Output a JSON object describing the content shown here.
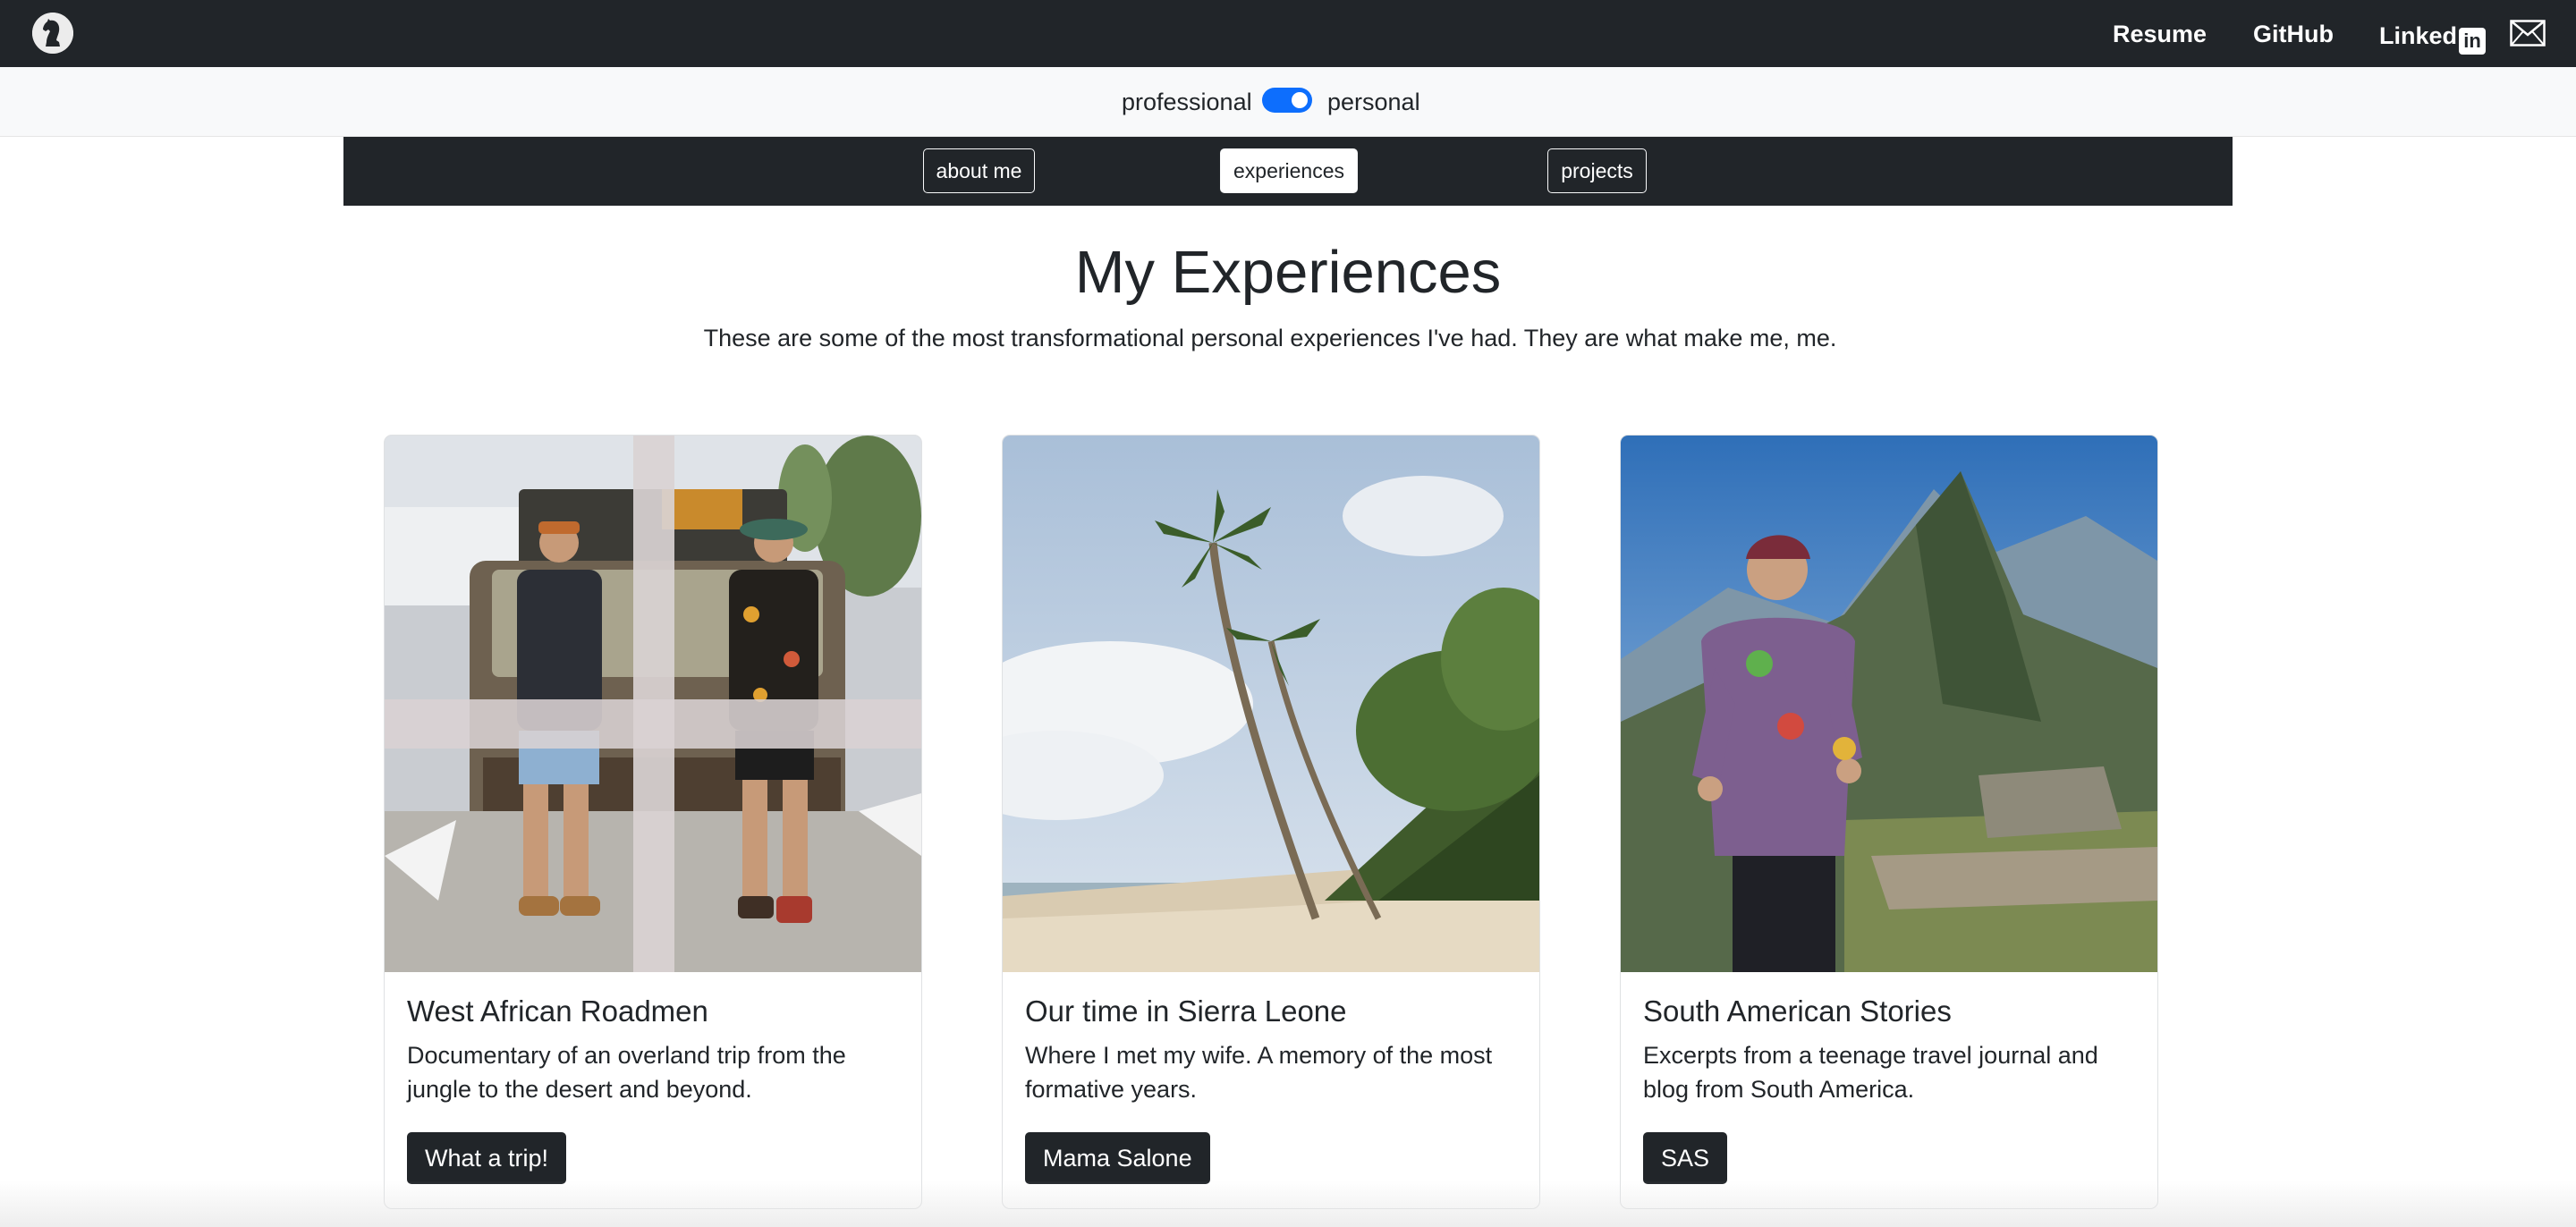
{
  "header": {
    "logo_icon": "chess-knight-icon",
    "links": [
      {
        "label": "Resume"
      },
      {
        "label": "GitHub"
      },
      {
        "label": "Linked",
        "badge": "in"
      }
    ],
    "mail_icon": "envelope-icon"
  },
  "toggle": {
    "left_label": "professional",
    "right_label": "personal",
    "state": "personal"
  },
  "section_nav": {
    "about": "about me",
    "experiences": "experiences",
    "projects": "projects",
    "active": "experiences"
  },
  "page": {
    "title": "My Experiences",
    "subtitle": "These are some of the most transformational personal experiences I've had. They are what make me, me."
  },
  "cards": [
    {
      "title": "West African Roadmen",
      "text": "Documentary of an overland trip from the jungle to the desert and beyond.",
      "button": "What a trip!",
      "image": "two men standing in front of a loaded car"
    },
    {
      "title": "Our time in Sierra Leone",
      "text": "Where I met my wife. A memory of the most formative years.",
      "button": "Mama Salone",
      "image": "palm trees on a tropical beach"
    },
    {
      "title": "South American Stories",
      "text": "Excerpts from a teenage travel journal and blog from South America.",
      "button": "SAS",
      "image": "man juggling in front of mountain ruins"
    }
  ],
  "colors": {
    "navbar": "#212529",
    "toggle_on": "#0d6efd",
    "light_bar": "#f8f9fa"
  }
}
